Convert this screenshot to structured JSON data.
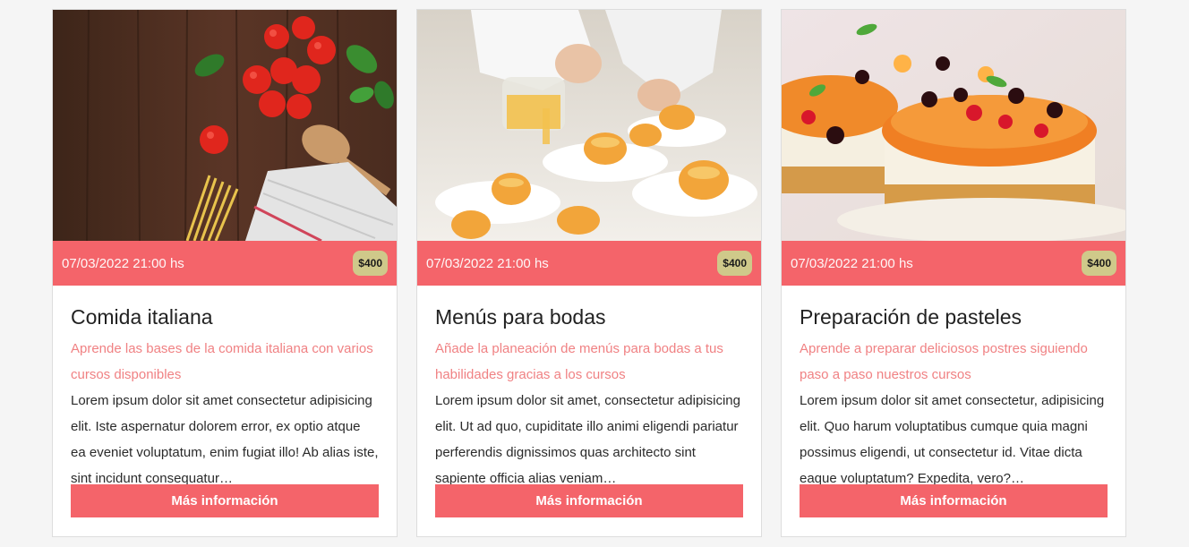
{
  "cards": [
    {
      "image": "italian-food-ingredients",
      "date": "07/03/2022 21:00 hs",
      "price": "$400",
      "title": "Comida italiana",
      "subtitle": "Aprende las bases de la comida italiana con varios cursos disponibles",
      "description": "Lorem ipsum dolor sit amet consectetur adipisicing elit. Iste aspernatur dolorem error, ex optio atque ea eveniet voluptatum, enim fugiat illo! Ab alias iste, sint incidunt consequatur…",
      "button": "Más información"
    },
    {
      "image": "wedding-menu-plating",
      "date": "07/03/2022 21:00 hs",
      "price": "$400",
      "title": "Menús para bodas",
      "subtitle": "Añade la planeación de menús para bodas a tus habilidades gracias a los cursos",
      "description": "Lorem ipsum dolor sit amet, consectetur adipisicing elit. Ut ad quo, cupiditate illo animi eligendi pariatur perferendis dignissimos quas architecto sint sapiente officia alias veniam…",
      "button": "Más información"
    },
    {
      "image": "fruit-cheesecakes",
      "date": "07/03/2022 21:00 hs",
      "price": "$400",
      "title": "Preparación de pasteles",
      "subtitle": "Aprende a preparar deliciosos postres siguiendo paso a paso nuestros cursos",
      "description": "Lorem ipsum dolor sit amet consectetur, adipisicing elit. Quo harum voluptatibus cumque quia magni possimus eligendi, ut consectetur id. Vitae dicta eaque voluptatum? Expedita, vero?…",
      "button": "Más información"
    }
  ],
  "colors": {
    "accent": "#f4646a",
    "price_badge": "#cfc98a",
    "subtitle": "#f08183",
    "background": "#f5f5f5"
  }
}
